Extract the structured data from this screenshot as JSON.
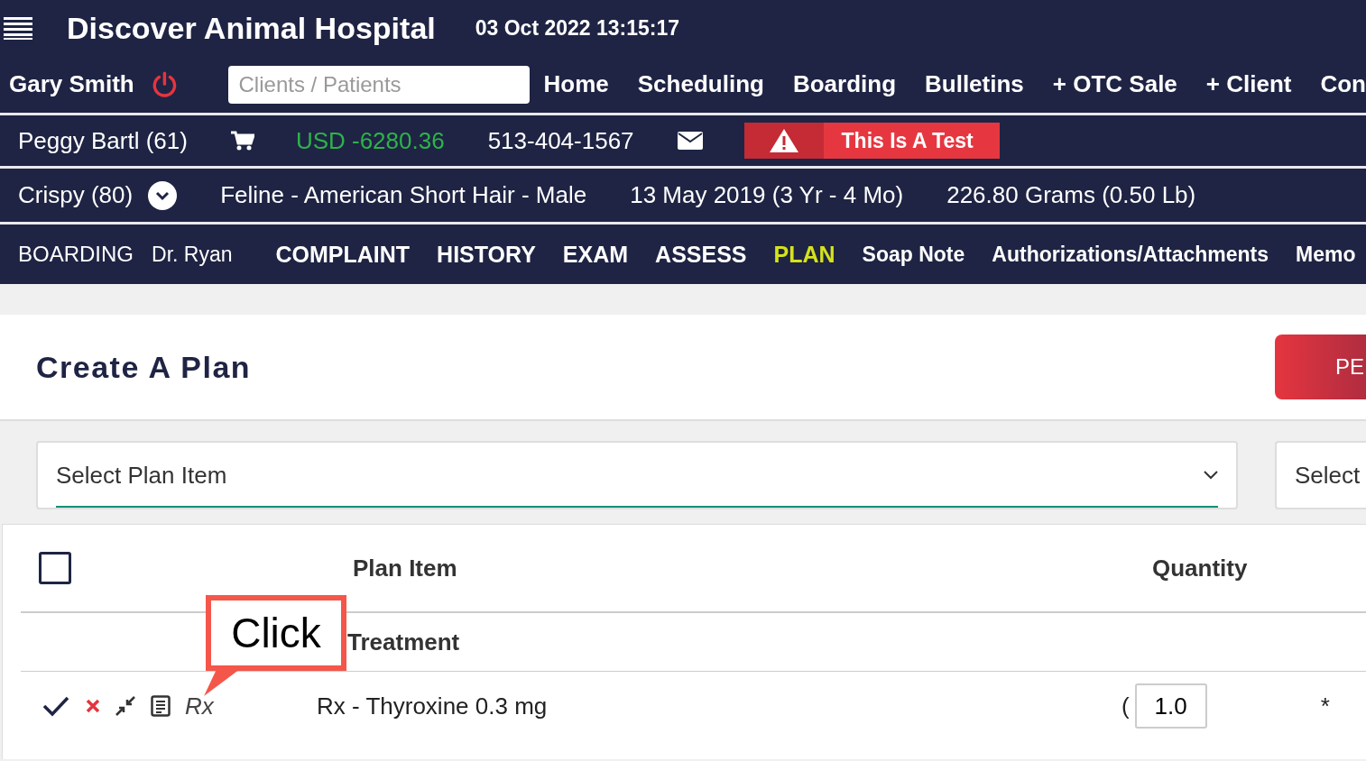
{
  "header": {
    "title": "Discover Animal Hospital",
    "datetime": "03 Oct 2022 13:15:17"
  },
  "user": {
    "name": "Gary Smith"
  },
  "search": {
    "placeholder": "Clients / Patients"
  },
  "nav": [
    "Home",
    "Scheduling",
    "Boarding",
    "Bulletins",
    "+ OTC Sale",
    "+ Client",
    "Con"
  ],
  "client": {
    "name": "Peggy Bartl (61)",
    "balance": "USD -6280.36",
    "phone": "513-404-1567",
    "alert": "This Is A Test"
  },
  "patient": {
    "name": "Crispy (80)",
    "breed": "Feline - American Short Hair - Male",
    "birth": "13 May 2019 (3 Yr - 4 Mo)",
    "weight": "226.80 Grams (0.50 Lb)"
  },
  "visit": {
    "status": "BOARDING",
    "doctor": "Dr. Ryan"
  },
  "tabs": [
    {
      "label": "COMPLAINT",
      "selected": false,
      "kind": "step"
    },
    {
      "label": "HISTORY",
      "selected": false,
      "kind": "step"
    },
    {
      "label": "EXAM",
      "selected": false,
      "kind": "step"
    },
    {
      "label": "ASSESS",
      "selected": false,
      "kind": "step"
    },
    {
      "label": "PLAN",
      "selected": true,
      "kind": "step"
    },
    {
      "label": "Soap Note",
      "selected": false,
      "kind": "link"
    },
    {
      "label": "Authorizations/Attachments",
      "selected": false,
      "kind": "link"
    },
    {
      "label": "Memo",
      "selected": false,
      "kind": "link"
    }
  ],
  "plan": {
    "title": "Create A Plan",
    "button": "PE",
    "select_placeholder": "Select Plan Item",
    "second_select": "Select"
  },
  "table": {
    "select_all": {
      "checked": false
    },
    "columns": [
      "Plan Item",
      "Quantity"
    ],
    "groups": [
      {
        "name": "Treatment",
        "rows": [
          {
            "type": "Rx",
            "item": "Rx - Thyroxine 0.3 mg",
            "paren": "(",
            "quantity": "1.0",
            "mark": "*"
          }
        ]
      }
    ]
  },
  "callout": "Click"
}
